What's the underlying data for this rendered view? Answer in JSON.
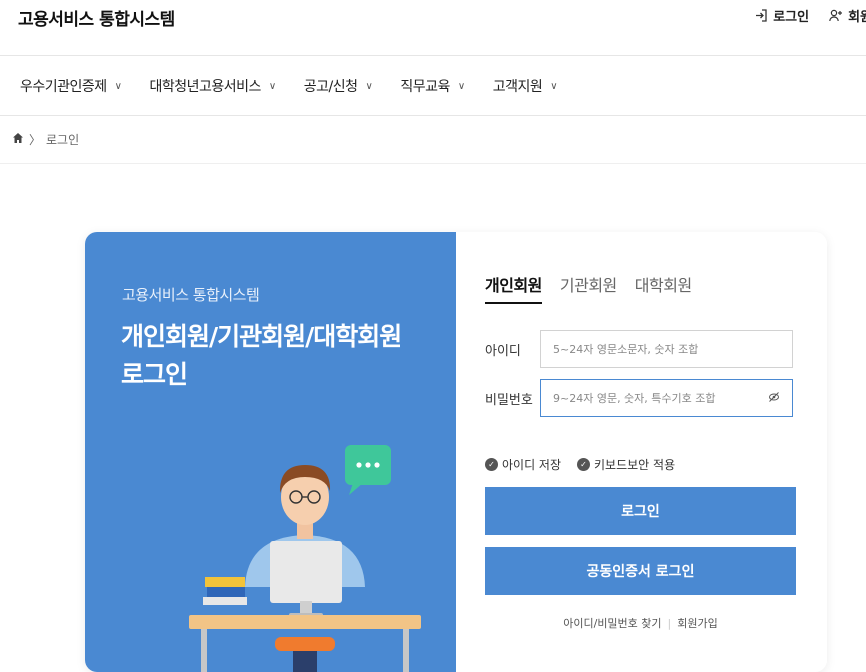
{
  "header": {
    "brand": "고용서비스 통합시스템",
    "login_label": "로그인",
    "signup_label": "회원"
  },
  "gnb": {
    "items": [
      {
        "label": "우수기관인증제"
      },
      {
        "label": "대학청년고용서비스"
      },
      {
        "label": "공고/신청"
      },
      {
        "label": "직무교육"
      },
      {
        "label": "고객지원"
      }
    ],
    "chevron": "∨"
  },
  "breadcrumb": {
    "separator": "〉",
    "current": "로그인"
  },
  "promo": {
    "subtitle": "고용서비스 통합시스템",
    "title_line1": "개인회원/기관회원/대학회원",
    "title_line2": "로그인"
  },
  "login": {
    "tabs": [
      {
        "label": "개인회원",
        "active": true
      },
      {
        "label": "기관회원",
        "active": false
      },
      {
        "label": "대학회원",
        "active": false
      }
    ],
    "id_label": "아이디",
    "id_placeholder": "5~24자 영문소문자, 숫자 조합",
    "pw_label": "비밀번호",
    "pw_placeholder": "9~24자 영문, 숫자, 특수기호 조합",
    "save_id_label": "아이디 저장",
    "keyboard_security_label": "키보드보안 적용",
    "login_button": "로그인",
    "cert_login_button": "공동인증서 로그인",
    "find_link": "아이디/비밀번호 찾기",
    "signup_link": "회원가입",
    "link_separator": "|"
  },
  "colors": {
    "accent": "#4a89d2"
  }
}
